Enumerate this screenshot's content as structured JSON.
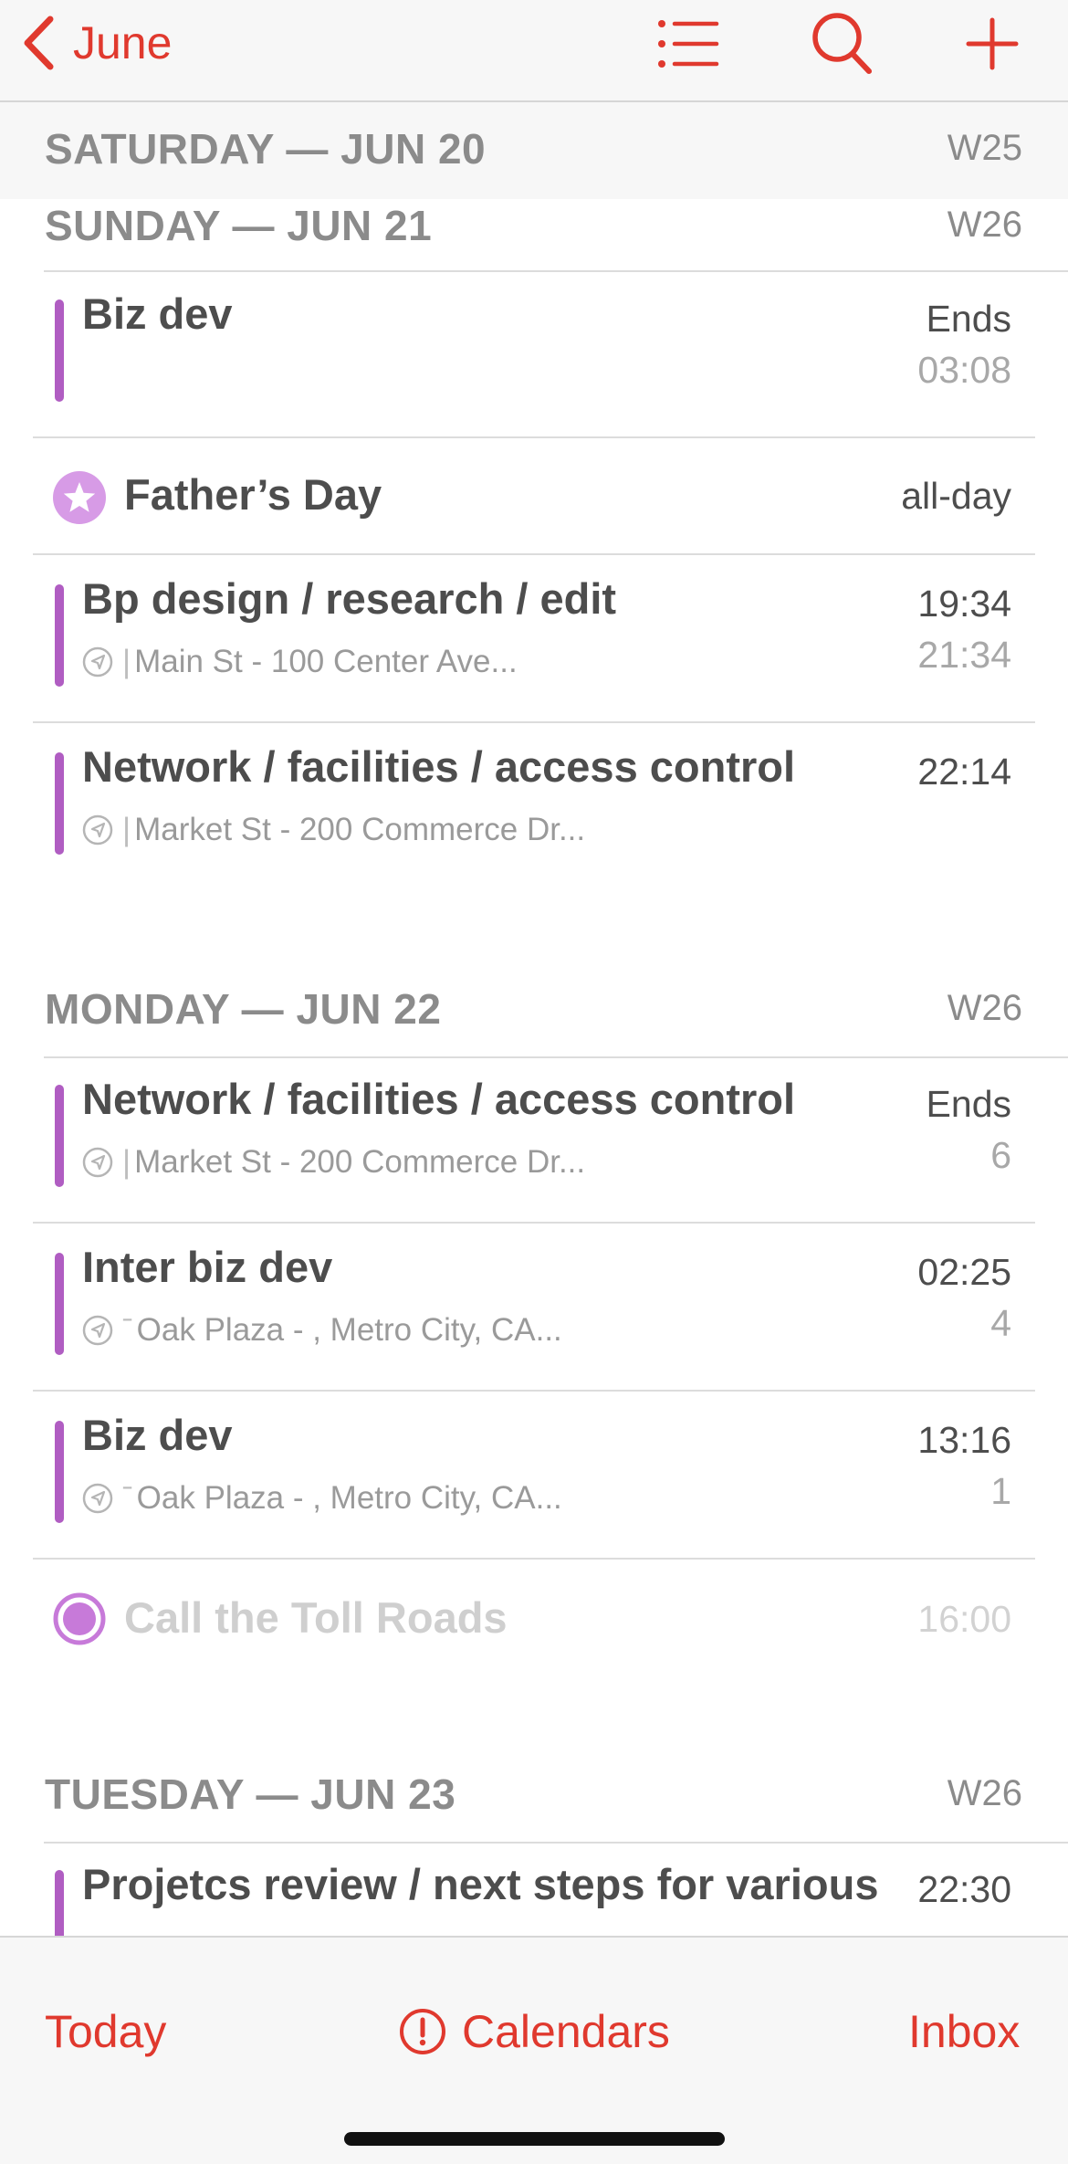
{
  "nav": {
    "back_label": "June",
    "back_icon": "chevron-left-icon",
    "list_icon": "list-icon",
    "search_icon": "search-icon",
    "add_icon": "plus-icon"
  },
  "sticky_day": {
    "title": "SATURDAY — JUN 20",
    "week": "W25"
  },
  "days": [
    {
      "title": "SUNDAY — JUN 21",
      "week": "W26",
      "events": [
        {
          "title": "Biz dev",
          "time1": "Ends",
          "time2": "03:08"
        },
        {
          "title": "Father’s Day",
          "time1": "all-day",
          "icon": "star-icon"
        },
        {
          "title": "Bp design / research / edit",
          "location": "Main St - 100 Center Ave...",
          "time1": "19:34",
          "time2": "21:34"
        },
        {
          "title": "Network / facilities / access control",
          "location": "Market St - 200 Commerce Dr...",
          "time1": "22:14"
        }
      ]
    },
    {
      "title": "MONDAY — JUN 22",
      "week": "W26",
      "events": [
        {
          "title": "Network / facilities / access control",
          "location": "Market St - 200 Commerce Dr...",
          "time1": "Ends",
          "time2": "6"
        },
        {
          "title": "Inter biz dev",
          "location": "Oak Plaza - , Metro City, CA...",
          "time1": "02:25",
          "time2": "4"
        },
        {
          "title": "Biz dev",
          "location": "Oak Plaza - , Metro City, CA...",
          "time1": "13:16",
          "time2": "1"
        },
        {
          "title": "Call the Toll Roads",
          "time1": "16:00",
          "icon": "reminder-circle-icon"
        }
      ]
    },
    {
      "title": "TUESDAY — JUN 23",
      "week": "W26",
      "events": [
        {
          "title": "Projetcs review / next steps for various",
          "time1": "22:30"
        }
      ]
    }
  ],
  "tabs": {
    "today": "Today",
    "calendars": "Calendars",
    "inbox": "Inbox",
    "calendars_icon": "alert-circle-icon"
  },
  "colors": {
    "accent": "#e0392e",
    "calendar_purple": "#b05dc2",
    "holiday_purple": "#d79be6"
  }
}
